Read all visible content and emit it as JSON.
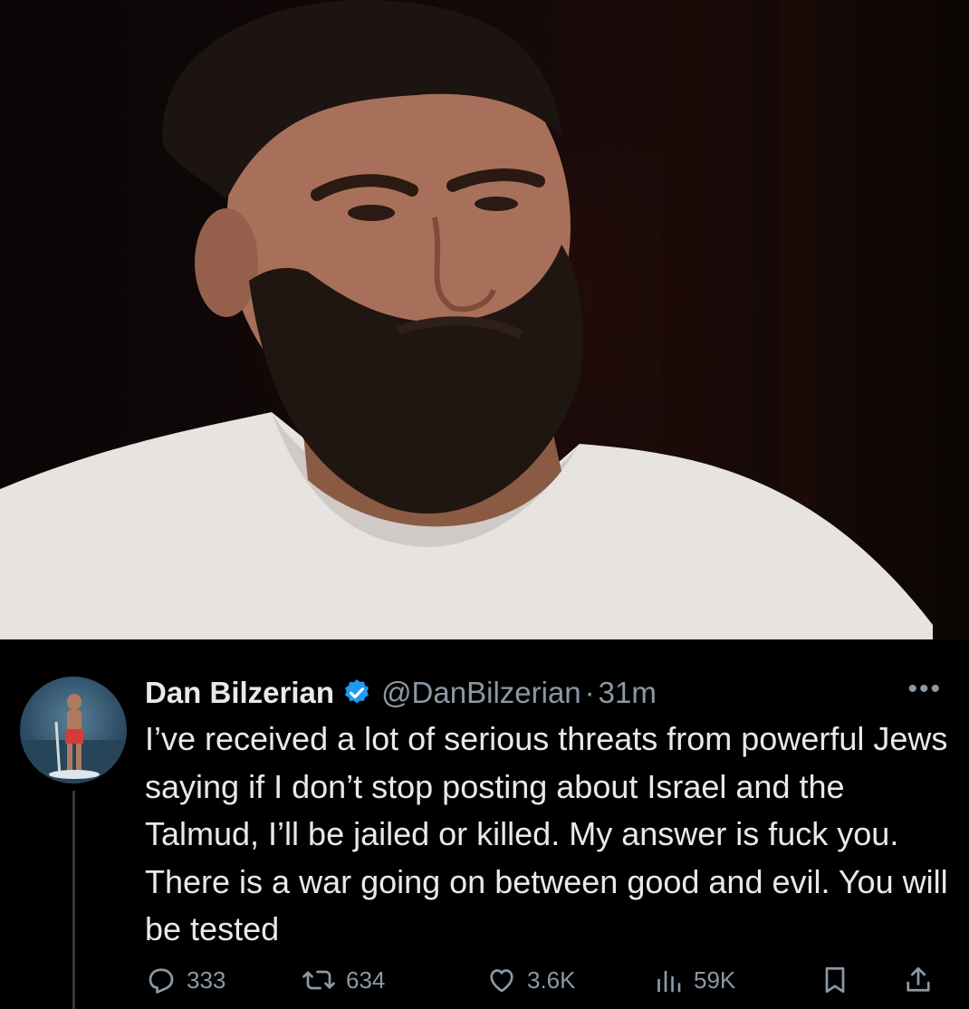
{
  "tweet": {
    "display_name": "Dan Bilzerian",
    "handle": "@DanBilzerian",
    "separator": "·",
    "time": "31m",
    "more_label": "•••",
    "text": "I’ve received a lot of serious threats from powerful Jews saying if I don’t stop posting about Israel and the Talmud, I’ll be jailed or killed. My answer is fuck you. There is a war going on between good and evil. You will be tested",
    "verified_color": "#1d9bf0"
  },
  "actions": {
    "replies": "333",
    "reposts": "634",
    "likes": "3.6K",
    "views": "59K"
  },
  "icons": [
    "verified-badge-icon",
    "reply-icon",
    "repost-icon",
    "like-icon",
    "views-icon",
    "bookmark-icon",
    "share-icon",
    "more-icon"
  ]
}
